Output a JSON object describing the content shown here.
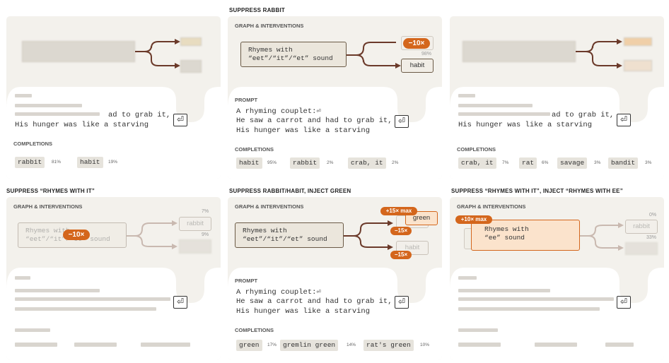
{
  "labels": {
    "graph": "GRAPH & INTERVENTIONS",
    "prompt": "PROMPT",
    "completions": "COMPLETIONS"
  },
  "prompt_lines": [
    "A rhyming couplet:⏎",
    "He saw a carrot and had to grab it,",
    "His hunger was like a starving"
  ],
  "prompt_tail": "ad to grab it,",
  "enter_glyph": "⏎",
  "feature_eet": [
    "Rhymes with",
    "“eet”/“it”/“et” sound"
  ],
  "feature_ee": [
    "Rhymes with",
    "“ee” sound"
  ],
  "panels": {
    "p2": {
      "title": "SUPPRESS RABBIT",
      "badge": "−10×",
      "ghost_pct": "98%",
      "habit_out": "habit",
      "completions": [
        {
          "text": "habit",
          "pct": "95%"
        },
        {
          "text": "rabbit",
          "pct": "2%"
        },
        {
          "text": "crab, it",
          "pct": "2%"
        }
      ]
    },
    "p3": {
      "completions": [
        {
          "text": "crab, it",
          "pct": "7%"
        },
        {
          "text": "rat",
          "pct": "6%"
        },
        {
          "text": "savage",
          "pct": "3%"
        },
        {
          "text": "bandit",
          "pct": "3%"
        }
      ]
    },
    "p1": {
      "completions": [
        {
          "text": "rabbit",
          "pct": "81%"
        },
        {
          "text": "habit",
          "pct": "19%"
        }
      ]
    },
    "p4": {
      "title": "SUPPRESS “RHYMES WITH IT”",
      "badge": "−10×",
      "pct_top": "7%",
      "pct_bottom": "9%",
      "rabbit_out": "rabbit"
    },
    "p5": {
      "title": "SUPPRESS RABBIT/HABIT, INJECT GREEN",
      "badge_inject": "+15× max",
      "badge_sup1": "−15×",
      "badge_sup2": "−15×",
      "green_out": "green",
      "habit_out": "habit",
      "completions": [
        {
          "text": "green",
          "pct": "17%"
        },
        {
          "text": "gremlin green",
          "pct": "14%"
        },
        {
          "text": "rat's green",
          "pct": "10%"
        }
      ]
    },
    "p6": {
      "title": "SUPPRESS “RHYMES WITH IT”, INJECT “RHYMES WITH EE”",
      "badge": "+10× max",
      "pct_top": "0%",
      "pct_bottom": "33%",
      "rabbit_out": "rabbit"
    }
  },
  "colors": {
    "accent": "#d4661c",
    "arrow": "#6b3a2a",
    "panel_bg": "#f3f1ec",
    "chip_bg": "#e6e3dc",
    "inject_bg": "#fbe3cc"
  }
}
